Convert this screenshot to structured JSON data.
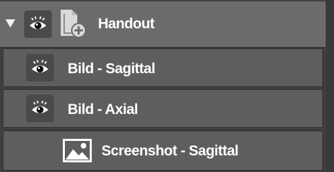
{
  "tree": {
    "group": {
      "label": "Handout",
      "expander_icon": "triangle-down-icon",
      "visibility_icon": "eye-icon",
      "type_icon": "document-add-icon"
    },
    "items": [
      {
        "label": "Bild - Sagittal",
        "icon": "eye-icon"
      },
      {
        "label": "Bild - Axial",
        "icon": "eye-icon"
      },
      {
        "label": "Screenshot - Sagittal",
        "icon": "image-icon"
      }
    ]
  },
  "colors": {
    "header_bg": "#6b6b6b",
    "row_bg": "#5e5e5e",
    "button_bg": "#4a4a4a",
    "text": "#ffffff"
  }
}
